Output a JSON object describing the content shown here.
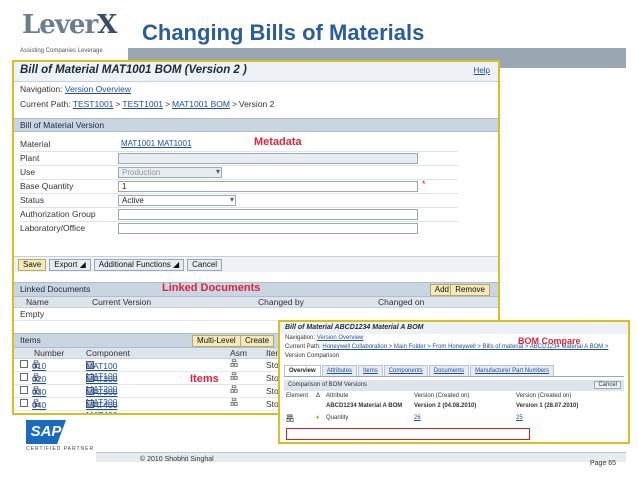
{
  "slide": {
    "title": "Changing Bills of Materials",
    "logo_text_1": "Lever",
    "logo_text_2": "X",
    "logo_tagline": "Assisting Companies Leverage",
    "copyright": "© 2010 Shobhit Singhal",
    "page": "Page 65",
    "sap_logo": "SAP",
    "sap_sub": "CERTIFIED PARTNER"
  },
  "colors": {
    "title": "#2a5d9a",
    "annotation": "#e0243c",
    "window_border": "#d4c31f",
    "section_bg": "#c9d5e1"
  },
  "window": {
    "title": "Bill of Material MAT1001 BOM (Version 2 )",
    "help": "Help",
    "navigation_label": "Navigation:",
    "navigation_link": "Version Overview",
    "path_label": "Current Path:",
    "path": [
      "TEST1001",
      "TEST1001",
      "MAT1001 BOM"
    ],
    "path_current": "Version 2",
    "path_sep": ">",
    "section_version": "Bill of Material Version",
    "annotation_metadata": "Metadata",
    "fields": {
      "material_label": "Material",
      "material_value": "MAT1001 MAT1001",
      "plant_label": "Plant",
      "plant_value": "",
      "use_label": "Use",
      "use_value": "Production",
      "base_qty_label": "Base Quantity",
      "base_qty_value": "1",
      "required_mark": "*",
      "status_label": "Status",
      "status_value": "Active",
      "auth_label": "Authorization Group",
      "auth_value": "",
      "lab_label": "Laboratory/Office",
      "lab_value": ""
    },
    "toolbar": {
      "save": "Save",
      "export": "Export ◢",
      "functions": "Additional Functions ◢",
      "cancel": "Cancel"
    },
    "linked": {
      "title": "Linked Documents",
      "annotation": "Linked Documents",
      "add": "Add",
      "remove": "Remove",
      "columns": [
        "Name",
        "Current Version",
        "Changed by",
        "Changed on"
      ],
      "empty": "Empty"
    },
    "items": {
      "title": "Items",
      "multilevel": "Multi-Level",
      "create": "Create",
      "annotation": "Items",
      "columns": [
        "Number",
        "Component",
        "Asm",
        "Item"
      ],
      "rows": [
        {
          "number": "010",
          "component": "MAT100 MAT100",
          "item": "Stoc"
        },
        {
          "number": "020",
          "component": "MAT200 MAT200",
          "item": "Stoc"
        },
        {
          "number": "030",
          "component": "MAT300 MAT300",
          "item": "Stoc"
        },
        {
          "number": "040",
          "component": "MAT400 MAT400",
          "item": "Stoc"
        }
      ]
    }
  },
  "overlay": {
    "title": "Bill of Material ABCD1234 Material A BOM",
    "annotation": "BOM Compare",
    "navigation_label": "Navigation:",
    "navigation_link": "Version Overview",
    "path_label": "Current Path:",
    "path": "Honeywell Collaboration > Main Folder > From Honeywell > Bills of material > ABCD1234 Material A BOM >",
    "path_2": "Version Comparison",
    "tabs": [
      "Overview",
      "Attributes",
      "Items",
      "Components",
      "Documents",
      "Manufacturer Part Numbers"
    ],
    "section": "Comparison of BOM Versions",
    "cancel": "Cancel",
    "columns": [
      "Element",
      "Δ",
      "Attribute",
      "Version (Created on)",
      "Version (Created on)"
    ],
    "header_row": [
      "",
      "",
      "ABCD1234 Material A BOM",
      "Version 2 (04.08.2010)",
      "Version 1 (28.07.2010)"
    ],
    "data_row": [
      "10",
      "♦",
      "Quantity",
      "26",
      "25"
    ]
  }
}
